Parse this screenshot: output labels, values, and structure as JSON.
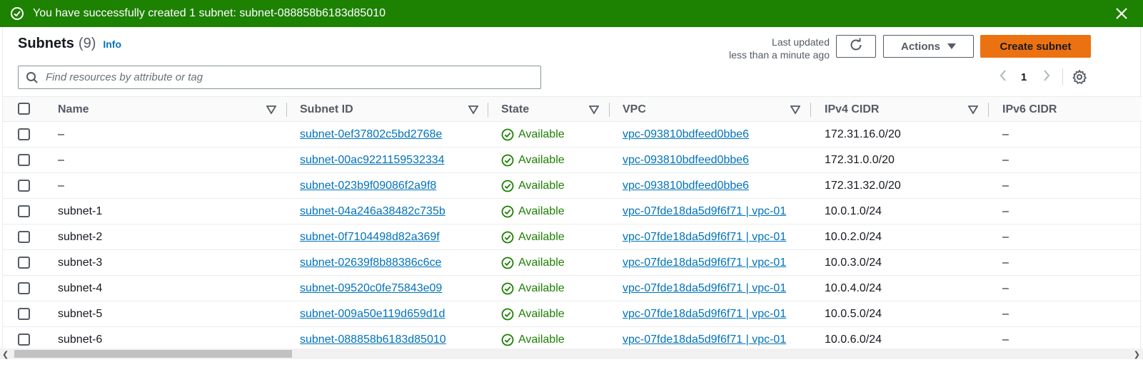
{
  "banner": {
    "message": "You have successfully created 1 subnet: subnet-088858b6183d85010",
    "color": "#1d8102"
  },
  "header": {
    "title": "Subnets",
    "count": "(9)",
    "info_label": "Info"
  },
  "last_updated": {
    "line1": "Last updated",
    "line2": "less than a minute ago"
  },
  "toolbar": {
    "actions_label": "Actions",
    "create_label": "Create subnet",
    "create_color": "#ec7211"
  },
  "search": {
    "placeholder": "Find resources by attribute or tag"
  },
  "pagination": {
    "current_page": "1"
  },
  "table": {
    "columns": [
      "Name",
      "Subnet ID",
      "State",
      "VPC",
      "IPv4 CIDR",
      "IPv6 CIDR"
    ],
    "rows": [
      {
        "name": "–",
        "subnet_id": "subnet-0ef37802c5bd2768e",
        "state": "Available",
        "vpc": "vpc-093810bdfeed0bbe6",
        "ipv4": "172.31.16.0/20",
        "ipv6": "–"
      },
      {
        "name": "–",
        "subnet_id": "subnet-00ac9221159532334",
        "state": "Available",
        "vpc": "vpc-093810bdfeed0bbe6",
        "ipv4": "172.31.0.0/20",
        "ipv6": "–"
      },
      {
        "name": "–",
        "subnet_id": "subnet-023b9f09086f2a9f8",
        "state": "Available",
        "vpc": "vpc-093810bdfeed0bbe6",
        "ipv4": "172.31.32.0/20",
        "ipv6": "–"
      },
      {
        "name": "subnet-1",
        "subnet_id": "subnet-04a246a38482c735b",
        "state": "Available",
        "vpc": "vpc-07fde18da5d9f6f71 | vpc-01",
        "ipv4": "10.0.1.0/24",
        "ipv6": "–"
      },
      {
        "name": "subnet-2",
        "subnet_id": "subnet-0f7104498d82a369f",
        "state": "Available",
        "vpc": "vpc-07fde18da5d9f6f71 | vpc-01",
        "ipv4": "10.0.2.0/24",
        "ipv6": "–"
      },
      {
        "name": "subnet-3",
        "subnet_id": "subnet-02639f8b88386c6ce",
        "state": "Available",
        "vpc": "vpc-07fde18da5d9f6f71 | vpc-01",
        "ipv4": "10.0.3.0/24",
        "ipv6": "–"
      },
      {
        "name": "subnet-4",
        "subnet_id": "subnet-09520c0fe75843e09",
        "state": "Available",
        "vpc": "vpc-07fde18da5d9f6f71 | vpc-01",
        "ipv4": "10.0.4.0/24",
        "ipv6": "–"
      },
      {
        "name": "subnet-5",
        "subnet_id": "subnet-009a50e119d659d1d",
        "state": "Available",
        "vpc": "vpc-07fde18da5d9f6f71 | vpc-01",
        "ipv4": "10.0.5.0/24",
        "ipv6": "–"
      },
      {
        "name": "subnet-6",
        "subnet_id": "subnet-088858b6183d85010",
        "state": "Available",
        "vpc": "vpc-07fde18da5d9f6f71 | vpc-01",
        "ipv4": "10.0.6.0/24",
        "ipv6": "–"
      }
    ]
  },
  "icons": {
    "banner_icon": "check-circle-icon",
    "close_icon": "close-icon",
    "refresh_icon": "refresh-icon",
    "search_icon": "search-icon",
    "settings_icon": "gear-icon",
    "state_icon": "check-circle-icon"
  }
}
